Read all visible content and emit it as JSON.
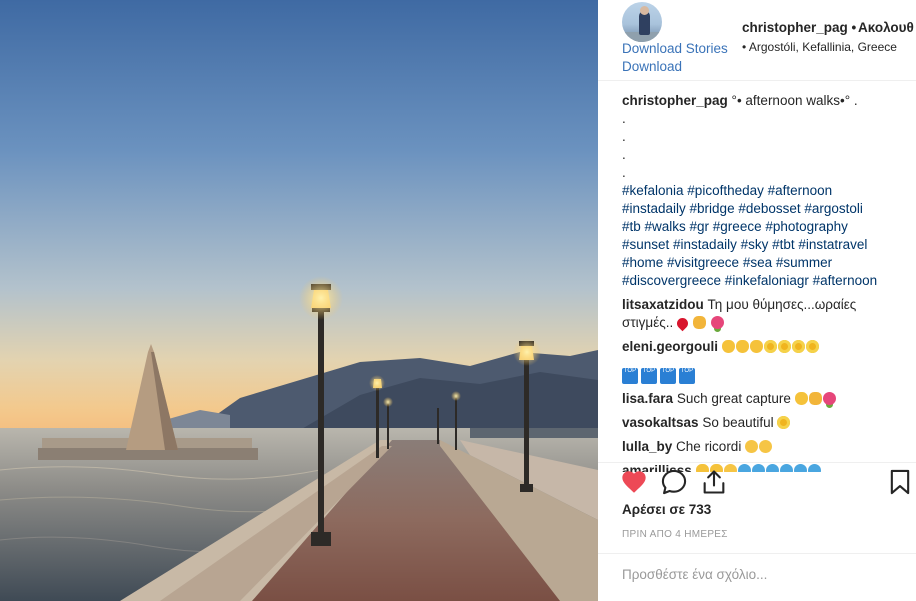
{
  "post": {
    "username": "christopher_pag",
    "separator": "•",
    "follow_label": "Ακολουθ",
    "location": "• Argostóli, Kefallinia, Greece",
    "download_stories": "Download Stories",
    "download": "Download"
  },
  "caption": {
    "username": "christopher_pag",
    "text": "°• afternoon walks•° .",
    "dots": [
      ".",
      ".",
      ".",
      "."
    ],
    "hashtag_lines": [
      "#kefalonia #picoftheday #afternoon",
      "#instadaily #bridge #debosset #argostoli",
      "#tb #walks #gr #greece #photography",
      "#sunset #instadaily #sky #tbt #instatravel",
      "#home #visitgreece #sea #summer",
      "#discovergreece #inkefaloniagr #afternoon"
    ]
  },
  "comments": [
    {
      "user": "litsaxatzidou",
      "text": "Τη μου θύμησες...ωραίες",
      "text2": "στιγμές.."
    },
    {
      "user": "eleni.georgouli",
      "text": "",
      "badges": [
        "TOP",
        "TOP",
        "TOP",
        "TOP"
      ]
    },
    {
      "user": "lisa.fara",
      "text": "Such great capture"
    },
    {
      "user": "vasokaltsas",
      "text": "So beautiful"
    },
    {
      "user": "lulla_by",
      "text": "Che ricordi"
    },
    {
      "user": "amarillisss",
      "text": ""
    }
  ],
  "likes_text": "Αρέσει σε 733",
  "time_text": "ΠΡΙΝ ΑΠΟ 4 ΗΜΕΡΕΣ",
  "add_comment_placeholder": "Προσθέστε ένα σχόλιο...",
  "icons": [
    "heart-icon",
    "comment-icon",
    "share-icon",
    "bookmark-icon"
  ],
  "colors": {
    "like": "#ed4956",
    "hashtag": "#003569",
    "link": "#3a73b8"
  }
}
